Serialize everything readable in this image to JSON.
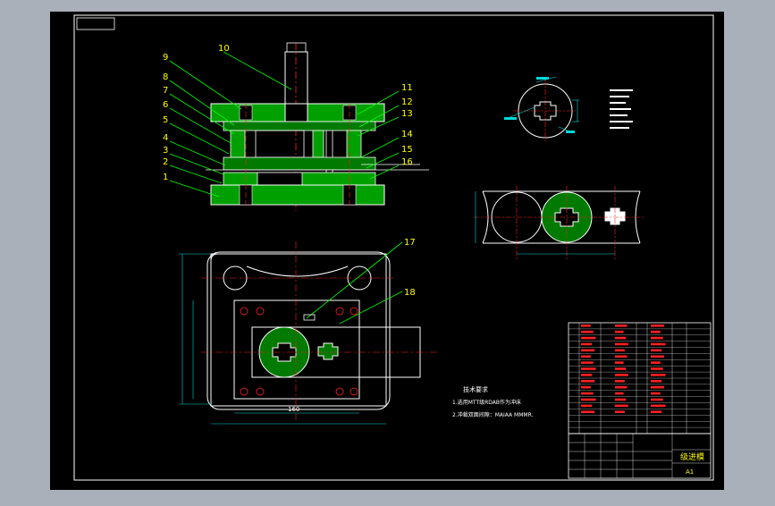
{
  "colors": {
    "frame_bg": "#aab0b9",
    "paper": "#000000",
    "line": "#ffffff",
    "leader": "#00ff00",
    "center": "#ff2020",
    "hatch": "#00b000",
    "dim": "#00d8d8",
    "label": "#ffff00",
    "table_red": "#ff2020"
  },
  "part_labels": [
    "9",
    "8",
    "7",
    "6",
    "5",
    "4",
    "3",
    "2",
    "1",
    "10",
    "11",
    "12",
    "13",
    "14",
    "15",
    "16",
    "17",
    "18"
  ],
  "technical_requirements": {
    "heading": "技术要求",
    "items": [
      "1.选用MTT级RDAB作为冲床",
      "2.冲裁双面间隙：MAIAA MMMR."
    ]
  },
  "title_block": {
    "drawing_name": "级进模",
    "sheet_size": "A1"
  },
  "dimension_text": {
    "bottom_width": "160"
  }
}
